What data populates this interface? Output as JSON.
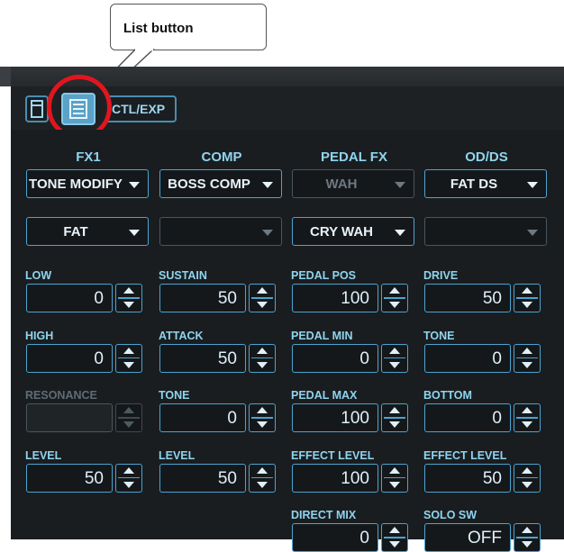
{
  "callout": {
    "text": "List button"
  },
  "toolbar": {
    "ctl_exp_label": "CTL/EXP"
  },
  "columns": [
    {
      "title": "FX1",
      "type_select": {
        "value": "TONE MODIFY",
        "enabled": true
      },
      "sub_select": {
        "value": "FAT",
        "enabled": true
      },
      "params": [
        {
          "label": "LOW",
          "value": "0",
          "enabled": true
        },
        {
          "label": "HIGH",
          "value": "0",
          "enabled": true
        },
        {
          "label": "RESONANCE",
          "value": "",
          "enabled": false
        },
        {
          "label": "LEVEL",
          "value": "50",
          "enabled": true
        }
      ]
    },
    {
      "title": "COMP",
      "type_select": {
        "value": "BOSS COMP",
        "enabled": true
      },
      "sub_select": {
        "value": "",
        "enabled": false
      },
      "params": [
        {
          "label": "SUSTAIN",
          "value": "50",
          "enabled": true
        },
        {
          "label": "ATTACK",
          "value": "50",
          "enabled": true
        },
        {
          "label": "TONE",
          "value": "0",
          "enabled": true
        },
        {
          "label": "LEVEL",
          "value": "50",
          "enabled": true
        }
      ]
    },
    {
      "title": "PEDAL FX",
      "type_select": {
        "value": "WAH",
        "enabled": false
      },
      "sub_select": {
        "value": "CRY WAH",
        "enabled": true
      },
      "params": [
        {
          "label": "PEDAL POS",
          "value": "100",
          "enabled": true
        },
        {
          "label": "PEDAL MIN",
          "value": "0",
          "enabled": true
        },
        {
          "label": "PEDAL MAX",
          "value": "100",
          "enabled": true
        },
        {
          "label": "EFFECT LEVEL",
          "value": "100",
          "enabled": true
        },
        {
          "label": "DIRECT MIX",
          "value": "0",
          "enabled": true
        }
      ]
    },
    {
      "title": "OD/DS",
      "type_select": {
        "value": "FAT DS",
        "enabled": true
      },
      "sub_select": {
        "value": "",
        "enabled": false
      },
      "params": [
        {
          "label": "DRIVE",
          "value": "50",
          "enabled": true
        },
        {
          "label": "TONE",
          "value": "0",
          "enabled": true
        },
        {
          "label": "BOTTOM",
          "value": "0",
          "enabled": true
        },
        {
          "label": "EFFECT LEVEL",
          "value": "50",
          "enabled": true
        },
        {
          "label": "SOLO SW",
          "value": "OFF",
          "enabled": true
        }
      ]
    }
  ]
}
